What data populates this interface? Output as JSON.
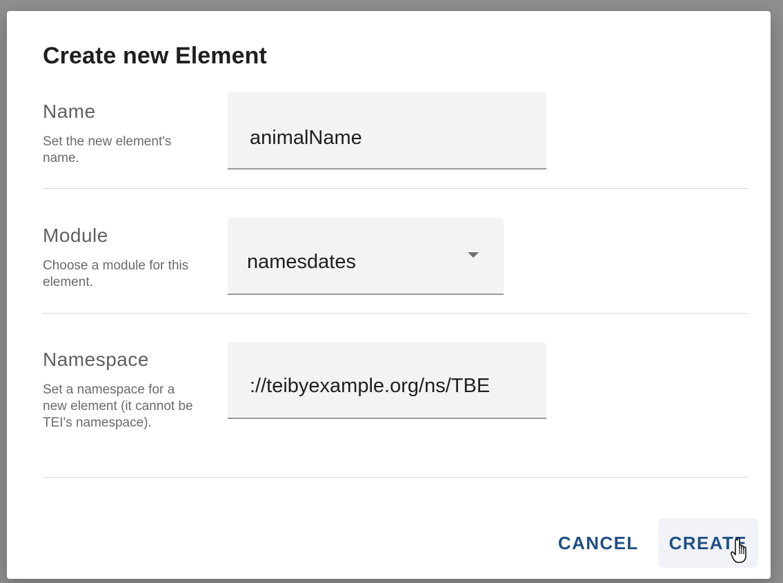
{
  "dialog": {
    "title": "Create new Element"
  },
  "fields": {
    "name": {
      "label": "Name",
      "hint": "Set the new element's name.",
      "value": "animalName"
    },
    "module": {
      "label": "Module",
      "hint": "Choose a module for this element.",
      "value": "namesdates",
      "icon": "chevron-down-icon"
    },
    "namespace": {
      "label": "Namespace",
      "hint": "Set a namespace for a new element (it cannot be TEI's namespace).",
      "value": "://teibyexample.org/ns/TBE"
    }
  },
  "actions": {
    "cancel_label": "CANCEL",
    "create_label": "CREATE"
  },
  "colors": {
    "accent": "#1f4f86",
    "field_bg": "#f3f3f3"
  }
}
